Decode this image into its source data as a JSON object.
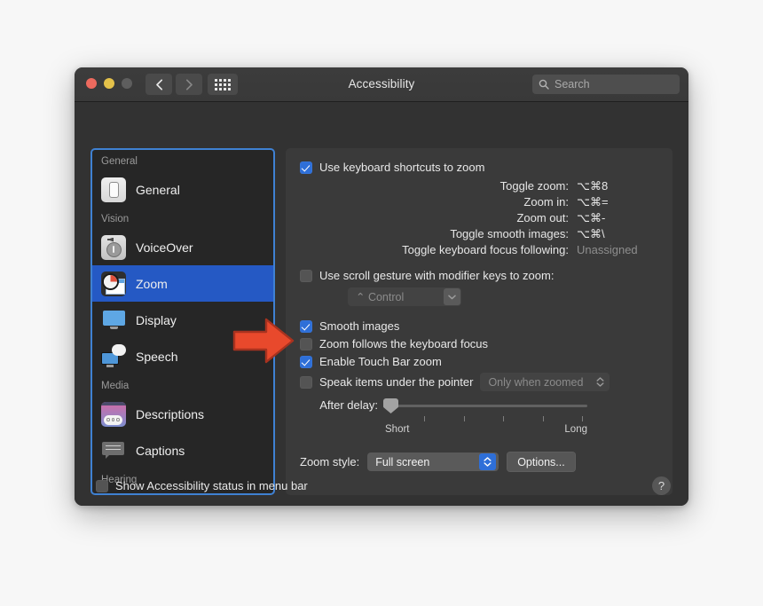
{
  "window": {
    "title": "Accessibility",
    "traffic_lights": [
      "close-button",
      "minimize-button",
      "zoom-button"
    ],
    "nav": {
      "back": "‹",
      "forward": "›",
      "grid": "show-all-button"
    },
    "search": {
      "placeholder": "Search",
      "value": ""
    }
  },
  "sidebar": {
    "groups": [
      {
        "header": "General",
        "items": [
          {
            "label": "General",
            "icon": "general-switch-icon",
            "selected": false
          }
        ]
      },
      {
        "header": "Vision",
        "items": [
          {
            "label": "VoiceOver",
            "icon": "voiceover-icon",
            "selected": false
          },
          {
            "label": "Zoom",
            "icon": "zoom-icon",
            "selected": true
          },
          {
            "label": "Display",
            "icon": "display-icon",
            "selected": false
          },
          {
            "label": "Speech",
            "icon": "speech-icon",
            "selected": false
          }
        ]
      },
      {
        "header": "Media",
        "items": [
          {
            "label": "Descriptions",
            "icon": "descriptions-icon",
            "selected": false
          },
          {
            "label": "Captions",
            "icon": "captions-icon",
            "selected": false
          }
        ]
      },
      {
        "header": "Hearing",
        "items": []
      }
    ]
  },
  "panel": {
    "keyboard_shortcuts": {
      "label": "Use keyboard shortcuts to zoom",
      "checked": true,
      "rows": [
        {
          "name": "Toggle zoom:",
          "key": "⌥⌘8",
          "unassigned": false
        },
        {
          "name": "Zoom in:",
          "key": "⌥⌘=",
          "unassigned": false
        },
        {
          "name": "Zoom out:",
          "key": "⌥⌘-",
          "unassigned": false
        },
        {
          "name": "Toggle smooth images:",
          "key": "⌥⌘\\",
          "unassigned": false
        },
        {
          "name": "Toggle keyboard focus following:",
          "key": "Unassigned",
          "unassigned": true
        }
      ]
    },
    "scroll_gesture": {
      "label": "Use scroll gesture with modifier keys to zoom:",
      "checked": false,
      "modifier_value": "⌃ Control",
      "disabled": true
    },
    "options": [
      {
        "label": "Smooth images",
        "checked": true
      },
      {
        "label": "Zoom follows the keyboard focus",
        "checked": false
      },
      {
        "label": "Enable Touch Bar zoom",
        "checked": true
      }
    ],
    "speak_items": {
      "label": "Speak items under the pointer",
      "checked": false,
      "popup_value": "Only when zoomed",
      "disabled": true
    },
    "after_delay": {
      "label": "After delay:",
      "min_label": "Short",
      "max_label": "Long",
      "value_percent": 0,
      "tick_count": 5
    },
    "zoom_style": {
      "label": "Zoom style:",
      "value": "Full screen",
      "options_button": "Options..."
    }
  },
  "bottom": {
    "status_checkbox": {
      "label": "Show Accessibility status in menu bar",
      "checked": false
    },
    "help_label": "?"
  },
  "annotation": {
    "arrow_color": "#e8492c",
    "arrow_outline": "#a8321f"
  },
  "colors": {
    "accent": "#2e6fd8",
    "selection": "#2559c4",
    "focus_ring": "#3f81d3",
    "window_bg": "#323232",
    "panel_bg": "#3a3a3a",
    "sidebar_bg": "#262626"
  }
}
